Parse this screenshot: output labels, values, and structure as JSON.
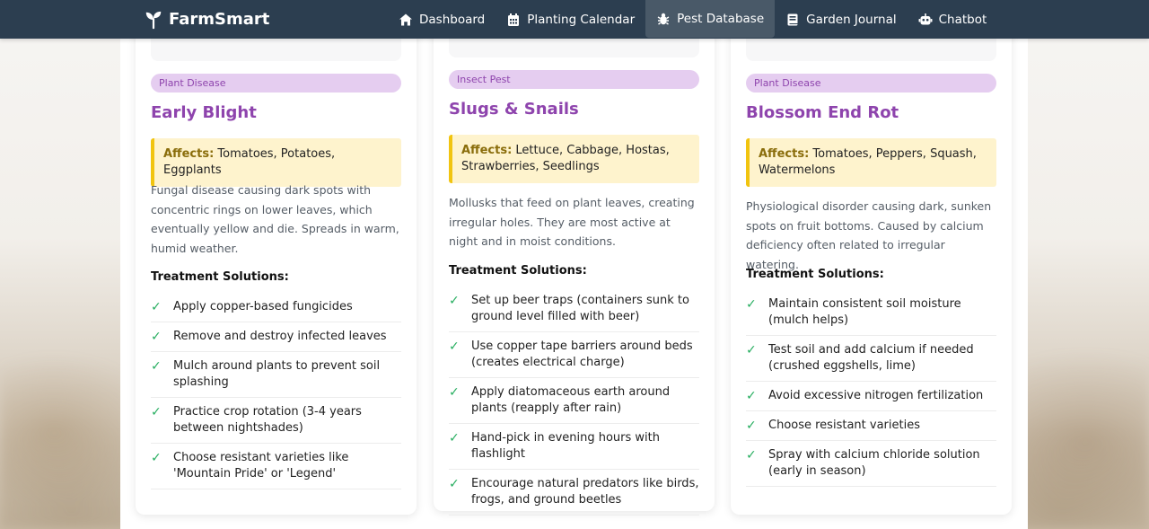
{
  "brand": {
    "name": "FarmSmart",
    "icon": "sprout-icon"
  },
  "nav": [
    {
      "label": "Dashboard",
      "icon": "home-icon",
      "active": false
    },
    {
      "label": "Planting Calendar",
      "icon": "calendar-icon",
      "active": false
    },
    {
      "label": "Pest Database",
      "icon": "bug-icon",
      "active": true
    },
    {
      "label": "Garden Journal",
      "icon": "book-icon",
      "active": false
    },
    {
      "label": "Chatbot",
      "icon": "robot-icon",
      "active": false
    }
  ],
  "cards": [
    {
      "tag": "Plant Disease",
      "title": "Early Blight",
      "affects_label": "Affects:",
      "affects": "Tomatoes, Potatoes, Eggplants",
      "description": "Fungal disease causing dark spots with concentric rings on lower leaves, which eventually yellow and die. Spreads in warm, humid weather.",
      "treatment_heading": "Treatment Solutions:",
      "treatments": [
        "Apply copper-based fungicides",
        "Remove and destroy infected leaves",
        "Mulch around plants to prevent soil splashing",
        "Practice crop rotation (3-4 years between nightshades)",
        "Choose resistant varieties like 'Mountain Pride' or 'Legend'"
      ]
    },
    {
      "tag": "Insect Pest",
      "title": "Slugs & Snails",
      "affects_label": "Affects:",
      "affects": "Lettuce, Cabbage, Hostas, Strawberries, Seedlings",
      "description": "Mollusks that feed on plant leaves, creating irregular holes. They are most active at night and in moist conditions.",
      "treatment_heading": "Treatment Solutions:",
      "treatments": [
        "Set up beer traps (containers sunk to ground level filled with beer)",
        "Use copper tape barriers around beds (creates electrical charge)",
        "Apply diatomaceous earth around plants (reapply after rain)",
        "Hand-pick in evening hours with flashlight",
        "Encourage natural predators like birds, frogs, and ground beetles"
      ]
    },
    {
      "tag": "Plant Disease",
      "title": "Blossom End Rot",
      "affects_label": "Affects:",
      "affects": "Tomatoes, Peppers, Squash, Watermelons",
      "description": "Physiological disorder causing dark, sunken spots on fruit bottoms. Caused by calcium deficiency often related to irregular watering.",
      "treatment_heading": "Treatment Solutions:",
      "treatments": [
        "Maintain consistent soil moisture (mulch helps)",
        "Test soil and add calcium if needed (crushed eggshells, lime)",
        "Avoid excessive nitrogen fertilization",
        "Choose resistant varieties",
        "Spray with calcium chloride solution (early in season)"
      ]
    }
  ],
  "colors": {
    "navbar": "#2c3e50",
    "accent_purple": "#8e44ad",
    "tag_bg": "#e5cdf0",
    "affects_bg": "#fef3cd",
    "affects_border": "#f1c40f",
    "check": "#27ae60"
  }
}
